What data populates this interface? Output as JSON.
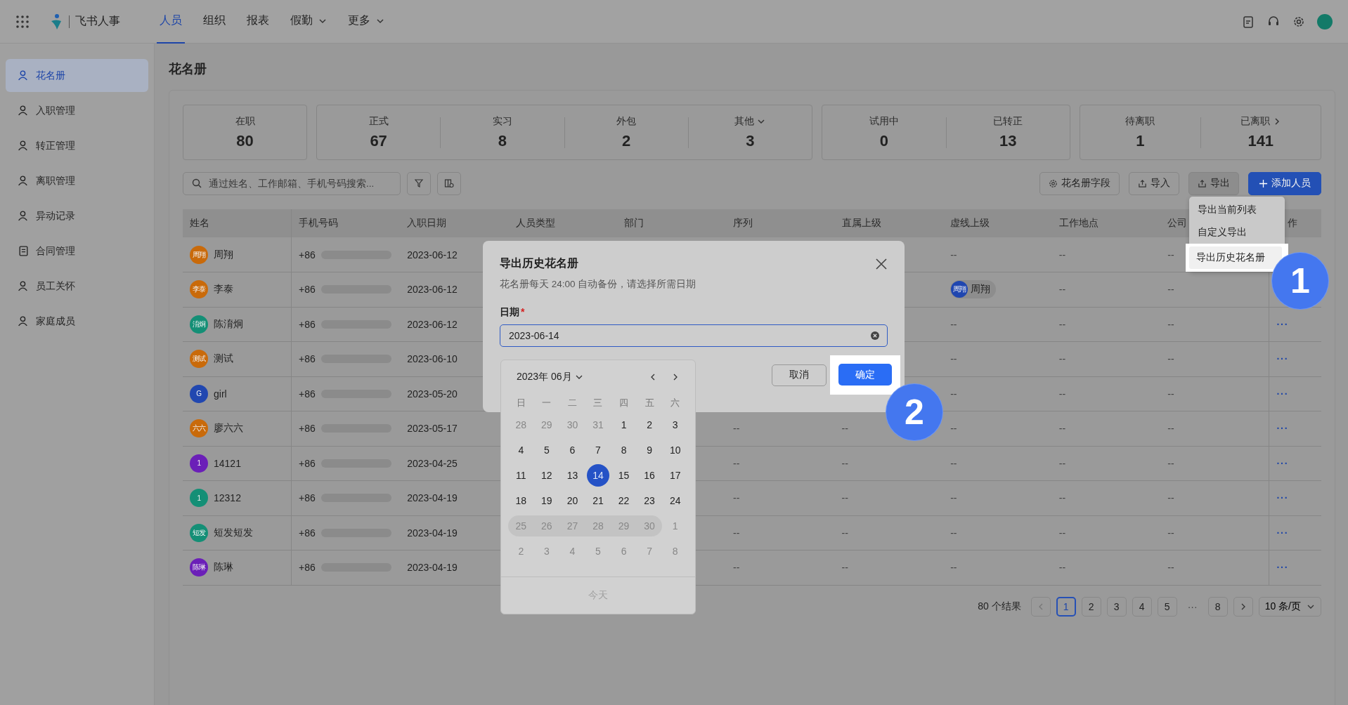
{
  "app": {
    "name": "飞书人事"
  },
  "nav": [
    {
      "label": "人员",
      "selected": true,
      "dropdown": false
    },
    {
      "label": "组织",
      "selected": false,
      "dropdown": false
    },
    {
      "label": "报表",
      "selected": false,
      "dropdown": false
    },
    {
      "label": "假勤",
      "selected": false,
      "dropdown": true
    },
    {
      "label": "更多",
      "selected": false,
      "dropdown": true
    }
  ],
  "sidebar": {
    "items": [
      {
        "label": "花名册",
        "selected": true
      },
      {
        "label": "入职管理",
        "selected": false
      },
      {
        "label": "转正管理",
        "selected": false
      },
      {
        "label": "离职管理",
        "selected": false
      },
      {
        "label": "异动记录",
        "selected": false
      },
      {
        "label": "合同管理",
        "selected": false
      },
      {
        "label": "员工关怀",
        "selected": false
      },
      {
        "label": "家庭成员",
        "selected": false
      }
    ]
  },
  "page_title": "花名册",
  "stat_groups": [
    [
      {
        "label": "在职",
        "value": "80",
        "kind": "plain"
      }
    ],
    [
      {
        "label": "正式",
        "value": "67",
        "kind": "plain"
      },
      {
        "label": "实习",
        "value": "8",
        "kind": "plain"
      },
      {
        "label": "外包",
        "value": "2",
        "kind": "plain"
      },
      {
        "label": "其他",
        "value": "3",
        "kind": "dropdown"
      }
    ],
    [
      {
        "label": "试用中",
        "value": "0",
        "kind": "plain"
      },
      {
        "label": "已转正",
        "value": "13",
        "kind": "plain"
      }
    ],
    [
      {
        "label": "待离职",
        "value": "1",
        "kind": "plain"
      },
      {
        "label": "已离职",
        "value": "141",
        "kind": "link"
      }
    ]
  ],
  "search": {
    "placeholder": "通过姓名、工作邮箱、手机号码搜索..."
  },
  "toolbar_buttons": [
    {
      "label": "花名册字段",
      "kind": "fields"
    },
    {
      "label": "导入",
      "kind": "import"
    },
    {
      "label": "导出",
      "kind": "export"
    },
    {
      "label": "添加人员",
      "kind": "primary"
    }
  ],
  "export_menu": [
    {
      "label": "导出当前列表",
      "highlighted": false
    },
    {
      "label": "自定义导出",
      "highlighted": false
    },
    {
      "label": "导出历史花名册",
      "highlighted": true
    }
  ],
  "table": {
    "columns": [
      "姓名",
      "手机号码",
      "入职日期",
      "人员类型",
      "部门",
      "序列",
      "直属上级",
      "虚线上级",
      "工作地点",
      "公司",
      "作"
    ],
    "rows": [
      {
        "avatar": "周翔",
        "color": "#c96a0a",
        "cells": [
          "周翔",
          "+86",
          "2023-06-12",
          null,
          null,
          null,
          null,
          "--",
          "--",
          "--",
          null
        ]
      },
      {
        "avatar": "李泰",
        "color": "#c96a0a",
        "cells": [
          "李泰",
          "+86",
          "2023-06-12",
          null,
          null,
          null,
          null,
          null,
          "--",
          "--",
          null
        ],
        "dotted_manager": {
          "avatar": "周翔",
          "name": "周翔"
        }
      },
      {
        "avatar": "淯炯",
        "color": "#148f76",
        "cells": [
          "陈淯炯",
          "+86",
          "2023-06-12",
          null,
          null,
          null,
          null,
          "--",
          "--",
          "--",
          "···"
        ]
      },
      {
        "avatar": "测试",
        "color": "#c96a0a",
        "cells": [
          "测试",
          "+86",
          "2023-06-10",
          null,
          null,
          null,
          null,
          "--",
          "--",
          "--",
          "···"
        ]
      },
      {
        "avatar": "G",
        "color": "#2147b0",
        "cells": [
          "girl",
          "+86",
          "2023-05-20",
          null,
          null,
          null,
          null,
          "--",
          "--",
          "--",
          "···"
        ]
      },
      {
        "avatar": "六六",
        "color": "#c96a0a",
        "cells": [
          "廖六六",
          "+86",
          "2023-05-17",
          null,
          null,
          "--",
          "--",
          "--",
          "--",
          "--",
          "···"
        ]
      },
      {
        "avatar": "1",
        "color": "#6b1fb8",
        "cells": [
          "14121",
          "+86",
          "2023-04-25",
          null,
          null,
          "--",
          "--",
          "--",
          "--",
          "--",
          "···"
        ]
      },
      {
        "avatar": "1",
        "color": "#148f76",
        "cells": [
          "12312",
          "+86",
          "2023-04-19",
          null,
          null,
          "--",
          "--",
          "--",
          "--",
          "--",
          "···"
        ]
      },
      {
        "avatar": "短发",
        "color": "#148f76",
        "cells": [
          "短发短发",
          "+86",
          "2023-04-19",
          null,
          null,
          "--",
          "--",
          "--",
          "--",
          "--",
          "···"
        ]
      },
      {
        "avatar": "陈琳",
        "color": "#6b1fb8",
        "cells": [
          "陈琳",
          "+86",
          "2023-04-19",
          null,
          null,
          "--",
          "--",
          "--",
          "--",
          "--",
          "···"
        ]
      }
    ]
  },
  "pagination": {
    "total": "80 个结果",
    "pages": [
      {
        "label": "1",
        "selected": true
      },
      {
        "label": "2",
        "selected": false
      },
      {
        "label": "3",
        "selected": false
      },
      {
        "label": "4",
        "selected": false
      },
      {
        "label": "5",
        "selected": false
      },
      {
        "label": "···",
        "selected": false,
        "kind": "ellipsis"
      },
      {
        "label": "8",
        "selected": false
      }
    ],
    "page_size": "10 条/页"
  },
  "dialog": {
    "title": "导出历史花名册",
    "description": "花名册每天 24:00 自动备份，请选择所需日期",
    "field_label": "日期",
    "required_mark": "*",
    "value": "2023-06-14",
    "buttons": [
      {
        "label": "取消",
        "kind": "secondary",
        "highlighted": false
      },
      {
        "label": "确定",
        "kind": "primary",
        "highlighted": true
      }
    ]
  },
  "calendar": {
    "month": "2023年 06月",
    "weekdays": [
      "日",
      "一",
      "二",
      "三",
      "四",
      "五",
      "六"
    ],
    "weeks": [
      [
        {
          "label": "28",
          "muted": true,
          "shaded": false,
          "selected": false
        },
        {
          "label": "29",
          "muted": true,
          "shaded": false,
          "selected": false
        },
        {
          "label": "30",
          "muted": true,
          "shaded": false,
          "selected": false
        },
        {
          "label": "31",
          "muted": true,
          "shaded": false,
          "selected": false
        },
        {
          "label": "1",
          "muted": false,
          "shaded": false,
          "selected": false
        },
        {
          "label": "2",
          "muted": false,
          "shaded": false,
          "selected": false
        },
        {
          "label": "3",
          "muted": false,
          "shaded": false,
          "selected": false
        }
      ],
      [
        {
          "label": "4",
          "muted": false,
          "shaded": false,
          "selected": false
        },
        {
          "label": "5",
          "muted": false,
          "shaded": false,
          "selected": false
        },
        {
          "label": "6",
          "muted": false,
          "shaded": false,
          "selected": false
        },
        {
          "label": "7",
          "muted": false,
          "shaded": false,
          "selected": false
        },
        {
          "label": "8",
          "muted": false,
          "shaded": false,
          "selected": false
        },
        {
          "label": "9",
          "muted": false,
          "shaded": false,
          "selected": false
        },
        {
          "label": "10",
          "muted": false,
          "shaded": false,
          "selected": false
        }
      ],
      [
        {
          "label": "11",
          "muted": false,
          "shaded": false,
          "selected": false
        },
        {
          "label": "12",
          "muted": false,
          "shaded": false,
          "selected": false
        },
        {
          "label": "13",
          "muted": false,
          "shaded": false,
          "selected": false
        },
        {
          "label": "14",
          "muted": false,
          "shaded": false,
          "selected": true
        },
        {
          "label": "15",
          "muted": false,
          "shaded": false,
          "selected": false
        },
        {
          "label": "16",
          "muted": false,
          "shaded": false,
          "selected": false
        },
        {
          "label": "17",
          "muted": false,
          "shaded": false,
          "selected": false
        }
      ],
      [
        {
          "label": "18",
          "muted": false,
          "shaded": false,
          "selected": false
        },
        {
          "label": "19",
          "muted": false,
          "shaded": false,
          "selected": false
        },
        {
          "label": "20",
          "muted": false,
          "shaded": false,
          "selected": false
        },
        {
          "label": "21",
          "muted": false,
          "shaded": false,
          "selected": false
        },
        {
          "label": "22",
          "muted": false,
          "shaded": false,
          "selected": false
        },
        {
          "label": "23",
          "muted": false,
          "shaded": false,
          "selected": false
        },
        {
          "label": "24",
          "muted": false,
          "shaded": false,
          "selected": false
        }
      ],
      [
        {
          "label": "25",
          "muted": true,
          "shaded": true,
          "selected": false
        },
        {
          "label": "26",
          "muted": true,
          "shaded": true,
          "selected": false
        },
        {
          "label": "27",
          "muted": true,
          "shaded": true,
          "selected": false
        },
        {
          "label": "28",
          "muted": true,
          "shaded": true,
          "selected": false
        },
        {
          "label": "29",
          "muted": true,
          "shaded": true,
          "selected": false
        },
        {
          "label": "30",
          "muted": true,
          "shaded": true,
          "selected": false
        },
        {
          "label": "1",
          "muted": true,
          "shaded": false,
          "selected": false
        }
      ],
      [
        {
          "label": "2",
          "muted": true,
          "shaded": false,
          "selected": false
        },
        {
          "label": "3",
          "muted": true,
          "shaded": false,
          "selected": false
        },
        {
          "label": "4",
          "muted": true,
          "shaded": false,
          "selected": false
        },
        {
          "label": "5",
          "muted": true,
          "shaded": false,
          "selected": false
        },
        {
          "label": "6",
          "muted": true,
          "shaded": false,
          "selected": false
        },
        {
          "label": "7",
          "muted": true,
          "shaded": false,
          "selected": false
        },
        {
          "label": "8",
          "muted": true,
          "shaded": false,
          "selected": false
        }
      ]
    ],
    "today": {
      "label": "今天",
      "disabled": true
    }
  },
  "step_badges": [
    "1",
    "2"
  ]
}
